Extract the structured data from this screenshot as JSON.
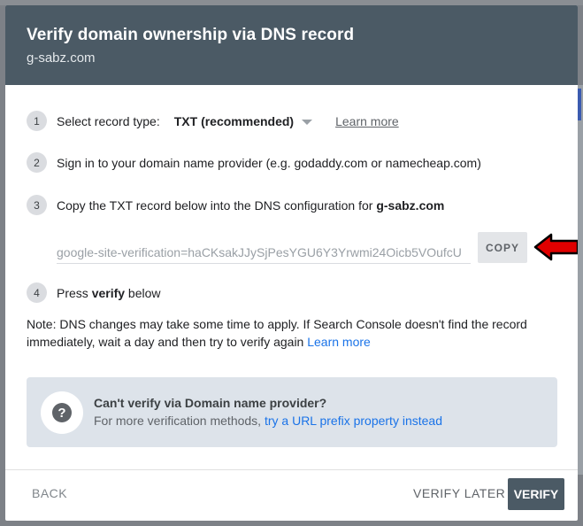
{
  "dialog": {
    "title": "Verify domain ownership via DNS record",
    "subtitle": "g-sabz.com"
  },
  "steps": [
    {
      "num": "1",
      "label": "Select record type:",
      "select_value": "TXT (recommended)",
      "learn_more": "Learn more"
    },
    {
      "num": "2",
      "label": "Sign in to your domain name provider (e.g. godaddy.com or namecheap.com)"
    },
    {
      "num": "3",
      "label": "Copy the TXT record below into the DNS configuration for ",
      "domain": "g-sabz.com"
    },
    {
      "num": "4",
      "label_pre": "Press ",
      "label_bold": "verify",
      "label_post": " below"
    }
  ],
  "txt_record": {
    "value": "google-site-verification=haCKsakJJySjPesYGU6Y3Yrwmi24Oicb5VOufcU",
    "copy_label": "COPY"
  },
  "note": {
    "text": "Note: DNS changes may take some time to apply. If Search Console doesn't find the record immediately, wait a day and then try to verify again ",
    "link": "Learn more"
  },
  "info_box": {
    "icon": "help-icon",
    "title": "Can't verify via Domain name provider?",
    "text": "For more verification methods, ",
    "link": "try a URL prefix property instead"
  },
  "footer": {
    "back_label": "BACK",
    "verify_later_label": "VERIFY LATER",
    "verify_label": "VERIFY"
  },
  "colors": {
    "header": "#4b5a65",
    "link": "#1a73e8",
    "arrow": "#e00000",
    "info_box": "#dde3ea"
  }
}
